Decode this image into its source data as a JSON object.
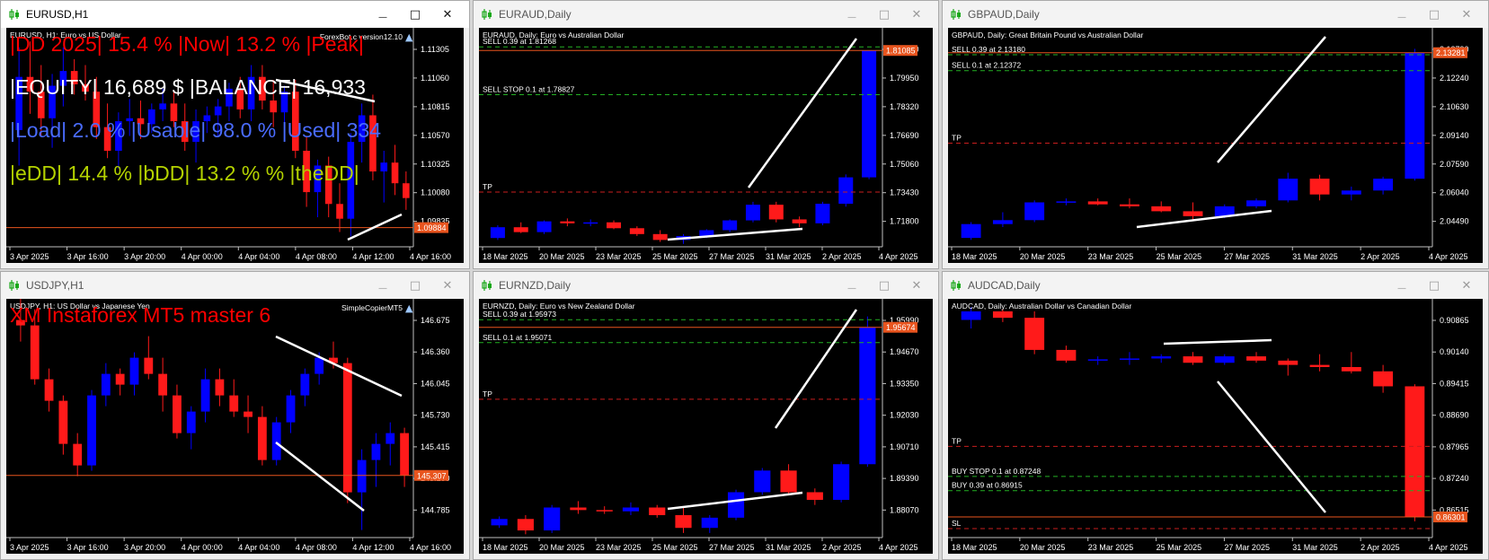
{
  "colors": {
    "up": "#0000ff",
    "down": "#ff1a1a",
    "white": "#ffffff",
    "bg": "#000000",
    "level_red": "#c81e1e",
    "level_green": "#23b023",
    "bid_line": "#e8541e",
    "bid_box": "#e8541e",
    "text_red": "#ff0000",
    "text_blue": "#4a6cff",
    "text_yellow": "#b4d200",
    "icon_green": "#1aa81a"
  },
  "windows": [
    {
      "title": "EURUSD,H1",
      "active": true,
      "chart_label": "EURUSD, H1:  Euro vs US Dollar",
      "expert": "ForexBot.c version12.10",
      "yticks": [
        "1.11305",
        "1.11060",
        "1.10815",
        "1.10570",
        "1.10325",
        "1.10080",
        "1.09835"
      ],
      "xticks": [
        "3 Apr 2025",
        "3 Apr 16:00",
        "3 Apr 20:00",
        "4 Apr 00:00",
        "4 Apr 04:00",
        "4 Apr 08:00",
        "4 Apr 12:00",
        "4 Apr 16:00"
      ],
      "price_label": "1.09884",
      "overlay": [
        {
          "text": "|DD 2025| 15.4 %  |Now| 13.2 % |Peak|",
          "color": "text_red"
        },
        {
          "text": "|EQUITY| 16,689 $  |BALANCE| 16,933",
          "color": "white"
        },
        {
          "text": "|Load| 2.0 %  |Usable| 98.0 %  |Used| 334",
          "color": "text_blue"
        },
        {
          "text": "|eDD| 14.4 %  |bDD| 13.2 %  %  |theDD|",
          "color": "text_yellow"
        }
      ],
      "levels": [],
      "candles": [
        [
          1.1054,
          1.111,
          1.103,
          1.109
        ],
        [
          1.109,
          1.1114,
          1.1065,
          1.108
        ],
        [
          1.108,
          1.1098,
          1.105,
          1.1062
        ],
        [
          1.1062,
          1.1092,
          1.1042,
          1.1084
        ],
        [
          1.1084,
          1.111,
          1.107,
          1.1094
        ],
        [
          1.1094,
          1.1102,
          1.1078,
          1.1085
        ],
        [
          1.1085,
          1.1098,
          1.1074,
          1.108
        ],
        [
          1.108,
          1.109,
          1.1048,
          1.1056
        ],
        [
          1.1056,
          1.1072,
          1.1035,
          1.104
        ],
        [
          1.104,
          1.1066,
          1.1028,
          1.106
        ],
        [
          1.106,
          1.1075,
          1.105,
          1.1062
        ],
        [
          1.1062,
          1.1074,
          1.1048,
          1.1058
        ],
        [
          1.1058,
          1.1072,
          1.1052,
          1.1068
        ],
        [
          1.1068,
          1.1082,
          1.106,
          1.1072
        ],
        [
          1.1072,
          1.108,
          1.1056,
          1.106
        ],
        [
          1.106,
          1.1072,
          1.104,
          1.1046
        ],
        [
          1.1046,
          1.1068,
          1.1032,
          1.106
        ],
        [
          1.106,
          1.107,
          1.1052,
          1.1064
        ],
        [
          1.1064,
          1.1075,
          1.105,
          1.107
        ],
        [
          1.107,
          1.1086,
          1.106,
          1.1082
        ],
        [
          1.1082,
          1.109,
          1.1062,
          1.1068
        ],
        [
          1.1068,
          1.1098,
          1.106,
          1.109
        ],
        [
          1.109,
          1.1098,
          1.1068,
          1.1074
        ],
        [
          1.1074,
          1.1088,
          1.1056,
          1.1066
        ],
        [
          1.1066,
          1.1084,
          1.1046,
          1.108
        ],
        [
          1.108,
          1.1088,
          1.1035,
          1.104
        ],
        [
          1.104,
          1.105,
          1.1002,
          1.1012
        ],
        [
          1.1012,
          1.1034,
          1.0995,
          1.103
        ],
        [
          1.103,
          1.1036,
          1.0995,
          1.1004
        ],
        [
          1.1004,
          1.1018,
          1.0985,
          1.0994
        ],
        [
          1.0994,
          1.1052,
          1.0982,
          1.1046
        ],
        [
          1.1046,
          1.1072,
          1.1032,
          1.1064
        ],
        [
          1.1064,
          1.1078,
          1.102,
          1.1026
        ],
        [
          1.1026,
          1.104,
          1.1005,
          1.1032
        ],
        [
          1.1032,
          1.1044,
          1.101,
          1.1018
        ],
        [
          1.1018,
          1.1026,
          1.1,
          1.1008
        ]
      ],
      "ymin": 1.0975,
      "ymax": 1.1122,
      "bid": 1.0988
    },
    {
      "title": "EURAUD,Daily",
      "active": false,
      "chart_label": "EURAUD, Daily:  Euro vs Australian Dollar",
      "expert": "",
      "yticks": [
        "1.81580",
        "1.79950",
        "1.78320",
        "1.76690",
        "1.75060",
        "1.73430",
        "1.71800"
      ],
      "xticks": [
        "18 Mar 2025",
        "20 Mar 2025",
        "23 Mar 2025",
        "25 Mar 2025",
        "27 Mar 2025",
        "31 Mar 2025",
        "2 Apr 2025",
        "4 Apr 2025"
      ],
      "price_label": "1.81085",
      "overlay": [],
      "levels": [
        {
          "text": "SELL 0.39 at 1.81268",
          "value": 1.81268,
          "style": "green"
        },
        {
          "text": "SELL STOP 0.1 at 1.78827",
          "value": 1.78827,
          "style": "green"
        },
        {
          "text": "TP",
          "value": 1.7385,
          "style": "red"
        }
      ],
      "candles": [
        [
          1.715,
          1.7215,
          1.714,
          1.7205
        ],
        [
          1.7205,
          1.723,
          1.7175,
          1.718
        ],
        [
          1.718,
          1.724,
          1.717,
          1.7235
        ],
        [
          1.7235,
          1.725,
          1.721,
          1.7225
        ],
        [
          1.7225,
          1.7245,
          1.721,
          1.723
        ],
        [
          1.723,
          1.724,
          1.7195,
          1.72
        ],
        [
          1.72,
          1.721,
          1.716,
          1.717
        ],
        [
          1.717,
          1.719,
          1.713,
          1.714
        ],
        [
          1.714,
          1.717,
          1.712,
          1.716
        ],
        [
          1.716,
          1.7195,
          1.715,
          1.719
        ],
        [
          1.719,
          1.7245,
          1.718,
          1.724
        ],
        [
          1.724,
          1.7335,
          1.723,
          1.732
        ],
        [
          1.732,
          1.7335,
          1.723,
          1.7245
        ],
        [
          1.7245,
          1.726,
          1.7205,
          1.7225
        ],
        [
          1.7225,
          1.7335,
          1.7215,
          1.7325
        ],
        [
          1.7325,
          1.7475,
          1.731,
          1.746
        ],
        [
          1.746,
          1.8108,
          1.745,
          1.8108
        ]
      ],
      "ymin": 1.7105,
      "ymax": 1.8215,
      "bid": 1.81085
    },
    {
      "title": "GBPAUD,Daily",
      "active": false,
      "chart_label": "GBPAUD, Daily:  Great Britain Pound vs Australian Dollar",
      "expert": "",
      "yticks": [
        "2.13790",
        "2.12240",
        "2.10630",
        "2.09140",
        "2.07590",
        "2.06040",
        "2.04490"
      ],
      "xticks": [
        "18 Mar 2025",
        "20 Mar 2025",
        "23 Mar 2025",
        "25 Mar 2025",
        "27 Mar 2025",
        "31 Mar 2025",
        "2 Apr 2025",
        "4 Apr 2025"
      ],
      "price_label": "2.13281",
      "overlay": [],
      "levels": [
        {
          "text": "SELL 0.39 at 2.13180",
          "value": 2.1318,
          "style": "green"
        },
        {
          "text": "SELL 0.1 at 2.12372",
          "value": 2.12372,
          "style": "green"
        },
        {
          "text": "TP",
          "value": 2.087,
          "style": "red"
        }
      ],
      "candles": [
        [
          2.039,
          2.047,
          2.038,
          2.046
        ],
        [
          2.046,
          2.052,
          2.0445,
          2.048
        ],
        [
          2.048,
          2.058,
          2.047,
          2.057
        ],
        [
          2.057,
          2.059,
          2.0555,
          2.0575
        ],
        [
          2.0575,
          2.059,
          2.0555,
          2.056
        ],
        [
          2.056,
          2.059,
          2.054,
          2.055
        ],
        [
          2.055,
          2.0575,
          2.052,
          2.0525
        ],
        [
          2.0525,
          2.057,
          2.048,
          2.05
        ],
        [
          2.05,
          2.056,
          2.049,
          2.055
        ],
        [
          2.055,
          2.059,
          2.054,
          2.058
        ],
        [
          2.058,
          2.072,
          2.057,
          2.069
        ],
        [
          2.069,
          2.071,
          2.058,
          2.061
        ],
        [
          2.061,
          2.065,
          2.058,
          2.063
        ],
        [
          2.063,
          2.07,
          2.061,
          2.069
        ],
        [
          2.069,
          2.1348,
          2.068,
          2.1328
        ]
      ],
      "ymin": 2.0345,
      "ymax": 2.1445,
      "bid": 2.13281
    },
    {
      "title": "USDJPY,H1",
      "active": false,
      "chart_label": "USDJPY, H1:  US Dollar vs Japanese Yen",
      "expert": "SimpleCopierMT5",
      "yticks": [
        "146.675",
        "146.360",
        "146.045",
        "145.730",
        "145.415",
        "145.100",
        "144.785"
      ],
      "xticks": [
        "3 Apr 2025",
        "3 Apr 16:00",
        "3 Apr 20:00",
        "4 Apr 00:00",
        "4 Apr 04:00",
        "4 Apr 08:00",
        "4 Apr 12:00",
        "4 Apr 16:00"
      ],
      "price_label": "145.307",
      "overlay": [
        {
          "text": "XM Instaforex MT5 master 6",
          "color": "text_red"
        }
      ],
      "levels": [],
      "candles": [
        [
          146.75,
          146.95,
          146.55,
          146.7
        ],
        [
          146.7,
          146.85,
          146.15,
          146.2
        ],
        [
          146.2,
          146.3,
          145.9,
          146.0
        ],
        [
          146.0,
          146.05,
          145.5,
          145.6
        ],
        [
          145.6,
          145.7,
          145.3,
          145.4
        ],
        [
          145.4,
          146.1,
          145.35,
          146.05
        ],
        [
          146.05,
          146.35,
          145.95,
          146.25
        ],
        [
          146.25,
          146.3,
          146.05,
          146.15
        ],
        [
          146.15,
          146.45,
          146.05,
          146.4
        ],
        [
          146.4,
          146.6,
          146.2,
          146.25
        ],
        [
          146.25,
          146.4,
          145.9,
          146.05
        ],
        [
          146.05,
          146.15,
          145.65,
          145.7
        ],
        [
          145.7,
          145.95,
          145.55,
          145.9
        ],
        [
          145.9,
          146.3,
          145.8,
          146.2
        ],
        [
          146.2,
          146.3,
          145.95,
          146.05
        ],
        [
          146.05,
          146.2,
          145.85,
          145.9
        ],
        [
          145.9,
          146.05,
          145.7,
          145.85
        ],
        [
          145.85,
          145.95,
          145.4,
          145.45
        ],
        [
          145.45,
          145.85,
          145.4,
          145.8
        ],
        [
          145.8,
          146.1,
          145.7,
          146.05
        ],
        [
          146.05,
          146.3,
          145.95,
          146.25
        ],
        [
          146.25,
          146.45,
          146.15,
          146.4
        ],
        [
          146.4,
          146.55,
          146.3,
          146.35
        ],
        [
          146.35,
          146.4,
          145.05,
          145.15
        ],
        [
          145.15,
          145.55,
          144.8,
          145.45
        ],
        [
          145.45,
          145.7,
          145.2,
          145.6
        ],
        [
          145.6,
          145.8,
          145.4,
          145.7
        ],
        [
          145.7,
          145.75,
          145.2,
          145.31
        ]
      ],
      "ymin": 144.73,
      "ymax": 146.93,
      "bid": 145.307
    },
    {
      "title": "EURNZD,Daily",
      "active": false,
      "chart_label": "EURNZD, Daily:  Euro vs New Zealand Dollar",
      "expert": "",
      "yticks": [
        "1.95990",
        "1.94670",
        "1.93350",
        "1.92030",
        "1.90710",
        "1.89390",
        "1.88070"
      ],
      "xticks": [
        "18 Mar 2025",
        "20 Mar 2025",
        "23 Mar 2025",
        "25 Mar 2025",
        "27 Mar 2025",
        "31 Mar 2025",
        "2 Apr 2025",
        "4 Apr 2025"
      ],
      "price_label": "1.95674",
      "overlay": [],
      "levels": [
        {
          "text": "SELL 0.39 at 1.95973",
          "value": 1.95973,
          "style": "green"
        },
        {
          "text": "SELL 0.1 at 1.95071",
          "value": 1.95071,
          "style": "green"
        },
        {
          "text": "TP",
          "value": 1.9285,
          "style": "red"
        }
      ],
      "candles": [
        [
          1.879,
          1.8825,
          1.878,
          1.8815
        ],
        [
          1.8815,
          1.883,
          1.8755,
          1.877
        ],
        [
          1.877,
          1.887,
          1.876,
          1.886
        ],
        [
          1.886,
          1.8885,
          1.8835,
          1.885
        ],
        [
          1.885,
          1.8865,
          1.8835,
          1.8845
        ],
        [
          1.8845,
          1.888,
          1.883,
          1.886
        ],
        [
          1.886,
          1.887,
          1.882,
          1.883
        ],
        [
          1.883,
          1.886,
          1.876,
          1.878
        ],
        [
          1.878,
          1.883,
          1.876,
          1.882
        ],
        [
          1.882,
          1.893,
          1.881,
          1.892
        ],
        [
          1.892,
          1.9015,
          1.891,
          1.9005
        ],
        [
          1.9005,
          1.903,
          1.891,
          1.892
        ],
        [
          1.892,
          1.8935,
          1.887,
          1.889
        ],
        [
          1.889,
          1.904,
          1.888,
          1.903
        ],
        [
          1.903,
          1.961,
          1.902,
          1.9567
        ]
      ],
      "ymin": 1.8742,
      "ymax": 1.9672,
      "bid": 1.95674
    },
    {
      "title": "AUDCAD,Daily",
      "active": false,
      "chart_label": "AUDCAD, Daily:  Australian Dollar vs Canadian Dollar",
      "expert": "",
      "yticks": [
        "0.90865",
        "0.90140",
        "0.89415",
        "0.88690",
        "0.87965",
        "0.87240",
        "0.86515"
      ],
      "xticks": [
        "18 Mar 2025",
        "20 Mar 2025",
        "23 Mar 2025",
        "25 Mar 2025",
        "27 Mar 2025",
        "31 Mar 2025",
        "2 Apr 2025",
        "4 Apr 2025"
      ],
      "price_label": "0.86301",
      "overlay": [],
      "levels": [
        {
          "text": "TP",
          "value": 0.8795,
          "style": "red"
        },
        {
          "text": "BUY STOP 0.1 at 0.87248",
          "value": 0.87248,
          "style": "green"
        },
        {
          "text": "BUY 0.39 at 0.86915",
          "value": 0.86915,
          "style": "green"
        },
        {
          "text": "SL",
          "value": 0.8603,
          "style": "red"
        }
      ],
      "candles": [
        [
          0.909,
          0.912,
          0.907,
          0.911
        ],
        [
          0.911,
          0.9115,
          0.9085,
          0.9095
        ],
        [
          0.9095,
          0.911,
          0.901,
          0.902
        ],
        [
          0.902,
          0.903,
          0.899,
          0.8995
        ],
        [
          0.8995,
          0.9005,
          0.8985,
          0.8998
        ],
        [
          0.8998,
          0.9015,
          0.8985,
          0.9
        ],
        [
          0.9,
          0.901,
          0.899,
          0.9005
        ],
        [
          0.9005,
          0.9015,
          0.8985,
          0.899
        ],
        [
          0.899,
          0.901,
          0.8985,
          0.9005
        ],
        [
          0.9005,
          0.9015,
          0.899,
          0.8995
        ],
        [
          0.8995,
          0.9,
          0.896,
          0.8985
        ],
        [
          0.8985,
          0.901,
          0.897,
          0.898
        ],
        [
          0.898,
          0.9015,
          0.8965,
          0.897
        ],
        [
          0.897,
          0.8985,
          0.892,
          0.8935
        ],
        [
          0.8935,
          0.894,
          0.862,
          0.863
        ]
      ],
      "ymin": 0.8582,
      "ymax": 0.9135,
      "bid": 0.86301
    }
  ]
}
